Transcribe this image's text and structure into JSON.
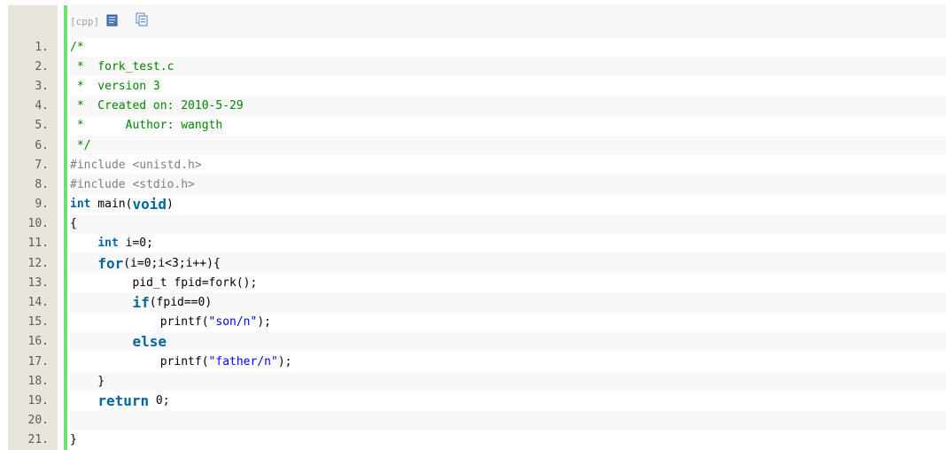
{
  "toolbar": {
    "lang_label": "[cpp]",
    "view_plain_icon": "document-icon",
    "copy_icon": "copy-icon"
  },
  "colors": {
    "gutter_bg": "#e7e5dc",
    "accent_bar": "#6ce26c",
    "comment": "#008200",
    "keyword": "#006699",
    "string": "#0000ff",
    "preprocessor": "#808080"
  },
  "lines": [
    {
      "n": "1.",
      "tokens": [
        {
          "t": "/*",
          "c": "comment"
        }
      ]
    },
    {
      "n": "2.",
      "tokens": [
        {
          "t": " *  fork_test.c",
          "c": "comment"
        }
      ]
    },
    {
      "n": "3.",
      "tokens": [
        {
          "t": " *  version 3",
          "c": "comment"
        }
      ]
    },
    {
      "n": "4.",
      "tokens": [
        {
          "t": " *  Created on: 2010-5-29",
          "c": "comment"
        }
      ]
    },
    {
      "n": "5.",
      "tokens": [
        {
          "t": " *      Author: wangth",
          "c": "comment"
        }
      ]
    },
    {
      "n": "6.",
      "tokens": [
        {
          "t": " */",
          "c": "comment"
        }
      ]
    },
    {
      "n": "7.",
      "tokens": [
        {
          "t": "#include <unistd.h>",
          "c": "pre"
        }
      ]
    },
    {
      "n": "8.",
      "tokens": [
        {
          "t": "#include <stdio.h>",
          "c": "pre"
        }
      ]
    },
    {
      "n": "9.",
      "tokens": [
        {
          "t": "int",
          "c": "kw"
        },
        {
          "t": " main(",
          "c": "plain"
        },
        {
          "t": "void",
          "c": "kw-big"
        },
        {
          "t": ")",
          "c": "plain"
        }
      ]
    },
    {
      "n": "10.",
      "tokens": [
        {
          "t": "{",
          "c": "plain"
        }
      ]
    },
    {
      "n": "11.",
      "tokens": [
        {
          "t": "    ",
          "c": "plain"
        },
        {
          "t": "int",
          "c": "kw"
        },
        {
          "t": " i=0;",
          "c": "plain"
        }
      ]
    },
    {
      "n": "12.",
      "tokens": [
        {
          "t": "    ",
          "c": "plain"
        },
        {
          "t": "for",
          "c": "kw-big"
        },
        {
          "t": "(i=0;i<3;i++){",
          "c": "plain"
        }
      ]
    },
    {
      "n": "13.",
      "tokens": [
        {
          "t": "         pid_t fpid=fork();",
          "c": "plain"
        }
      ]
    },
    {
      "n": "14.",
      "tokens": [
        {
          "t": "         ",
          "c": "plain"
        },
        {
          "t": "if",
          "c": "kw-big"
        },
        {
          "t": "(fpid==0)",
          "c": "plain"
        }
      ]
    },
    {
      "n": "15.",
      "tokens": [
        {
          "t": "             printf(",
          "c": "plain"
        },
        {
          "t": "\"son/n\"",
          "c": "str"
        },
        {
          "t": ");",
          "c": "plain"
        }
      ]
    },
    {
      "n": "16.",
      "tokens": [
        {
          "t": "         ",
          "c": "plain"
        },
        {
          "t": "else",
          "c": "kw-big"
        }
      ]
    },
    {
      "n": "17.",
      "tokens": [
        {
          "t": "             printf(",
          "c": "plain"
        },
        {
          "t": "\"father/n\"",
          "c": "str"
        },
        {
          "t": ");",
          "c": "plain"
        }
      ]
    },
    {
      "n": "18.",
      "tokens": [
        {
          "t": "    }",
          "c": "plain"
        }
      ]
    },
    {
      "n": "19.",
      "tokens": [
        {
          "t": "    ",
          "c": "plain"
        },
        {
          "t": "return",
          "c": "kw-big"
        },
        {
          "t": " 0;",
          "c": "plain"
        }
      ]
    },
    {
      "n": "20.",
      "tokens": [
        {
          "t": "",
          "c": "plain"
        }
      ]
    },
    {
      "n": "21.",
      "tokens": [
        {
          "t": "}",
          "c": "plain"
        }
      ]
    }
  ]
}
